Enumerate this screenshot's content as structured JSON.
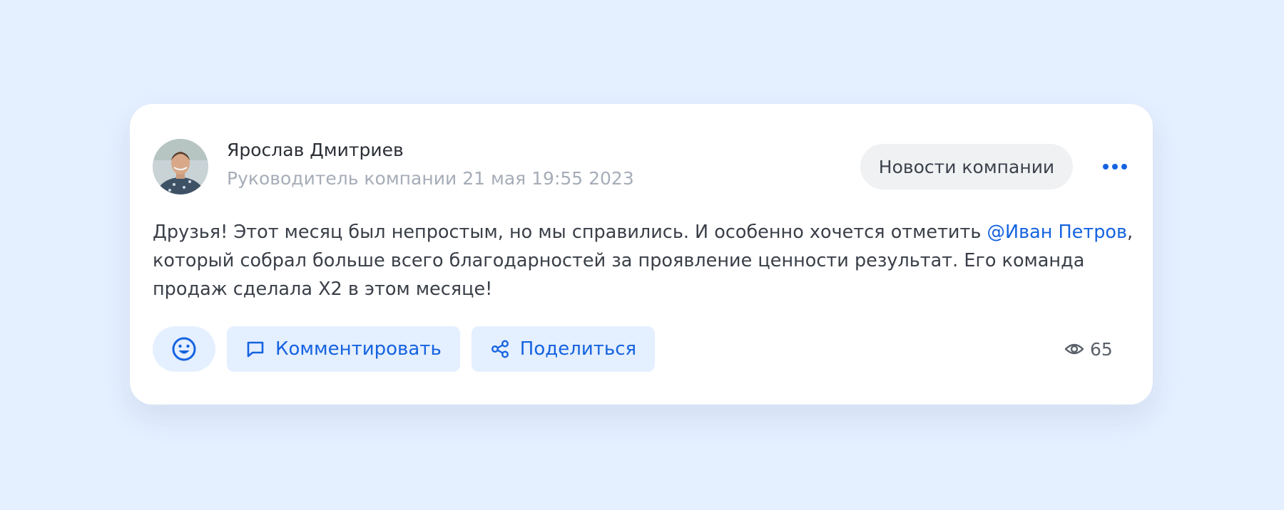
{
  "post": {
    "author": {
      "name": "Ярослав Дмитриев",
      "role": "Руководитель компании",
      "date": "21 мая 19:55 2023"
    },
    "category": "Новости компании",
    "text": {
      "line1_before": "Друзья! Этот месяц был непростым, но мы справились. И особенно хочется отметить ",
      "mention": "@Иван Петров",
      "line1_after": ",",
      "line2": "который собрал больше всего благодарностей за проявление ценности результат. Его команда",
      "line3": "продаж сделала X2 в этом месяце!"
    },
    "actions": {
      "react_icon": "smile-icon",
      "comment_label": "Комментировать",
      "comment_icon": "comment-icon",
      "share_label": "Поделиться",
      "share_icon": "share-icon"
    },
    "views": {
      "icon": "eye-icon",
      "count": "65"
    }
  },
  "colors": {
    "background": "#e4efff",
    "card": "#ffffff",
    "accent": "#1563e0",
    "badge": "#f0f1f3",
    "muted_text": "#a6adb8"
  }
}
